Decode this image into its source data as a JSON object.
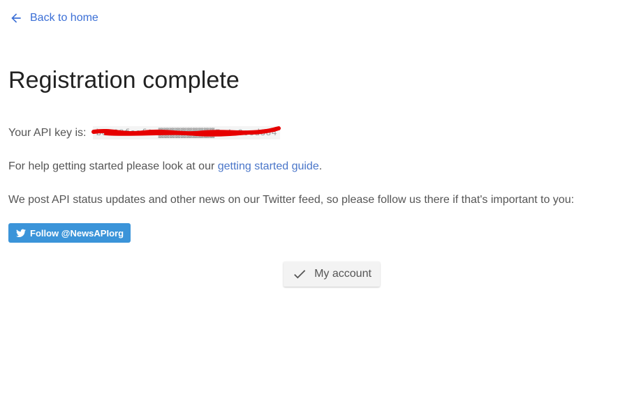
{
  "nav": {
    "back_label": "Back to home",
    "back_icon": "arrow-left-icon"
  },
  "page": {
    "title": "Registration complete"
  },
  "api_key": {
    "label": "Your API key is:",
    "value": "bee68fcaf1c▓▓▓▓▓▓▓▓▓▓7c4a6ecd384",
    "redacted": true,
    "redaction_color": "#e60000"
  },
  "help": {
    "prefix": "For help getting started please look at our ",
    "link_text": "getting started guide",
    "suffix": "."
  },
  "twitter": {
    "text": "We post API status updates and other news on our Twitter feed, so please follow us there if that's important to you:",
    "button_label": "Follow @NewsAPIorg",
    "button_icon": "twitter-bird-icon",
    "button_color": "#3b94d9"
  },
  "account_button": {
    "label": "My account",
    "icon": "checkmark-icon"
  },
  "colors": {
    "link": "#3b6fd6",
    "text": "#555555",
    "title": "#222222"
  }
}
